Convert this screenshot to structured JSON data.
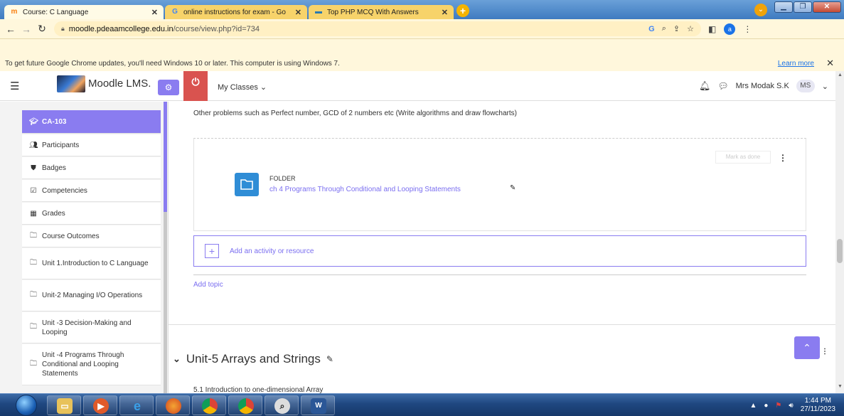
{
  "browser": {
    "tabs": [
      {
        "title": "Course: C Language",
        "favicon": "moodle-favicon",
        "active": true
      },
      {
        "title": "online instructions for exam - Go",
        "favicon": "google-favicon",
        "active": false
      },
      {
        "title": "Top PHP MCQ With Answers",
        "favicon": "site-favicon",
        "active": false
      }
    ],
    "url_host": "moodle.pdeaamcollege.edu.in",
    "url_path": "/course/view.php?id=734",
    "profile_initial": "a",
    "infobar_message": "To get future Google Chrome updates, you'll need Windows 10 or later. This computer is using Windows 7.",
    "infobar_link": "Learn more"
  },
  "navbar": {
    "site_name": "Moodle LMS.",
    "my_classes": "My Classes",
    "user_name": "Mrs Modak S.K",
    "user_initials": "MS"
  },
  "drawer": {
    "items": [
      {
        "label": "CA-103",
        "icon": "graduation-cap-icon",
        "active": true
      },
      {
        "label": "Participants",
        "icon": "users-icon"
      },
      {
        "label": "Badges",
        "icon": "shield-icon"
      },
      {
        "label": "Competencies",
        "icon": "checkbox-icon"
      },
      {
        "label": "Grades",
        "icon": "table-icon"
      },
      {
        "label": "Course Outcomes",
        "icon": "folder-icon"
      },
      {
        "label": "Unit 1.Introduction to C Language",
        "icon": "folder-icon"
      },
      {
        "label": "Unit-2 Managing I/O Operations",
        "icon": "folder-icon"
      },
      {
        "label": "Unit -3 Decision-Making and Looping",
        "icon": "folder-icon"
      },
      {
        "label": "Unit -4 Programs Through Conditional and Looping Statements",
        "icon": "folder-icon"
      }
    ]
  },
  "main": {
    "intro_text": "Other problems such as Perfect number, GCD of 2 numbers etc (Write algorithms and draw flowcharts)",
    "mark_done_label": "Mark as done",
    "folder": {
      "type_label": "FOLDER",
      "name": "ch 4 Programs Through Conditional and Looping Statements"
    },
    "add_activity_label": "Add an activity or resource",
    "add_topic_label": "Add topic",
    "next_section_title": "Unit-5 Arrays and Strings",
    "next_section_first_item": "5.1 Introduction to one-dimensional Array"
  },
  "taskbar": {
    "apps": [
      "explorer",
      "media-player",
      "internet-explorer",
      "firefox",
      "chrome",
      "chrome-profile",
      "magnifier",
      "word"
    ],
    "time": "1:44 PM",
    "date": "27/11/2023"
  },
  "colors": {
    "accent": "#8a7cf0",
    "danger": "#d9534f",
    "folder_blue": "#2f8dd6",
    "link": "#7a6ef0"
  }
}
